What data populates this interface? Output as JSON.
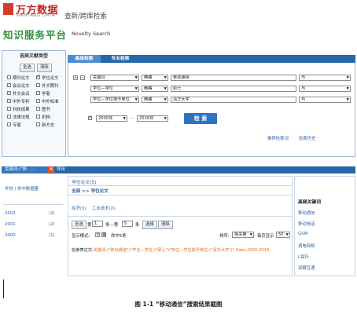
{
  "brand": {
    "logo_cn": "万方数据",
    "logo_en": "WANFANG DATA",
    "page_title": "查新/跨库检索",
    "slogan": "知识服务平台",
    "slogan_en": "Novelty Search"
  },
  "doc_types": {
    "heading": "选择文献类型",
    "select_all": "全选",
    "clear": "清除",
    "items": [
      {
        "label": "期刊论文",
        "checked": false
      },
      {
        "label": "学位论文",
        "checked": true
      },
      {
        "label": "会议论文",
        "checked": false
      },
      {
        "label": "外文期刊",
        "checked": false
      },
      {
        "label": "外文会议",
        "checked": false
      },
      {
        "label": "学者",
        "checked": false
      },
      {
        "label": "中外专利",
        "checked": false
      },
      {
        "label": "中外标准",
        "checked": false
      },
      {
        "label": "科技成果",
        "checked": false
      },
      {
        "label": "图书",
        "checked": false
      },
      {
        "label": "法律法规",
        "checked": false
      },
      {
        "label": "机构",
        "checked": false
      },
      {
        "label": "专家",
        "checked": false
      },
      {
        "label": "新方志",
        "checked": false
      }
    ]
  },
  "tabs": {
    "advanced": "高级检索",
    "expert": "专业检索"
  },
  "conditions": [
    {
      "field": "关键词",
      "match": "精确",
      "value": "移动通信",
      "logic": "与"
    },
    {
      "field": "学位—学位",
      "match": "精确",
      "value": "硕士",
      "logic": "与"
    },
    {
      "field": "学位—学位授予单位",
      "match": "精确",
      "value": "清华大学",
      "logic": "与"
    }
  ],
  "year_range": {
    "from": "2000年",
    "to": "2016年",
    "sep": "–"
  },
  "search_button": "检 索",
  "links": {
    "recommend": "推荐检索词",
    "history": "检索历史"
  },
  "result_bar": {
    "tab_label": "关键词:(\"移……",
    "close": "×",
    "export": "导出"
  },
  "left_results": {
    "heading": "年份 / 命中数据量",
    "years": [
      {
        "year": "2002",
        "count": "(2)"
      },
      {
        "year": "2001",
        "count": "(2)"
      },
      {
        "year": "2000",
        "count": "(1)"
      }
    ]
  },
  "middle": {
    "header": "学位论文(5)",
    "breadcrumb": "全部 >> 学位论文",
    "tabs": [
      "经济(3)",
      "工业技术(2)"
    ],
    "select_all": "全选",
    "page_prefix": "第",
    "page_value": "1",
    "page_mid": "条—第",
    "page_to": "5",
    "page_suffix": "条",
    "select_btn": "选择",
    "clear_btn": "清除",
    "display_mode_label": "显示模式:",
    "hit_label": "命中5条",
    "sort_label": "排序:",
    "sort_value": "相关度",
    "per_page_label": "每页显示",
    "per_page_value": "50",
    "expression_label": "检索表达式:",
    "expression": "关键词:(\"移动通信\")*学位—学位:(\"硕士\")*学位—学位授予单位:(\"清华大学\")* Date:2000-2016"
  },
  "related": {
    "title": "高频关键词",
    "items": [
      "移动通信",
      "移动电话",
      "GSM",
      "调电网络",
      "L探针",
      "双鞭互通"
    ]
  },
  "caption": "图 1-1 “移动通信”搜索结果截图"
}
